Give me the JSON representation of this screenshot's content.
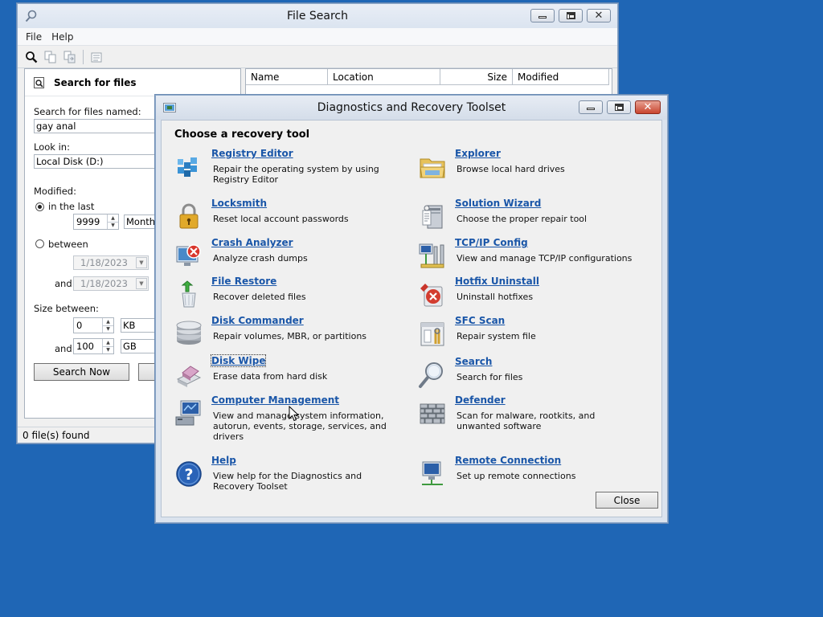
{
  "file_search": {
    "title": "File Search",
    "menu": [
      "File",
      "Help"
    ],
    "panel_title": "Search for files",
    "search_named_label": "Search for files named:",
    "search_named_value": "gay anal",
    "look_in_label": "Look in:",
    "look_in_value": "Local Disk (D:)",
    "modified_label": "Modified:",
    "in_the_last_label": "in the last",
    "in_the_last_value": "9999",
    "in_the_last_unit": "Months",
    "between_label": "between",
    "date_from": "1/18/2023",
    "and_label": "and",
    "date_to": "1/18/2023",
    "size_between_label": "Size between:",
    "size_min": "0",
    "size_min_unit": "KB",
    "size_and_label": "and",
    "size_max": "100",
    "size_max_unit": "GB",
    "search_button": "Search Now",
    "columns": [
      "Name",
      "Location",
      "Size",
      "Modified"
    ],
    "status": "0 file(s) found"
  },
  "dart": {
    "title": "Diagnostics and Recovery Toolset",
    "heading": "Choose a recovery tool",
    "tools_left": [
      {
        "name": "Registry Editor",
        "desc": "Repair the operating system by using Registry Editor",
        "icon": "registry-icon"
      },
      {
        "name": "Locksmith",
        "desc": "Reset local account passwords",
        "icon": "padlock-icon"
      },
      {
        "name": "Crash Analyzer",
        "desc": "Analyze crash dumps",
        "icon": "crash-icon"
      },
      {
        "name": "File Restore",
        "desc": "Recover deleted files",
        "icon": "recycle-bin-icon"
      },
      {
        "name": "Disk Commander",
        "desc": "Repair volumes, MBR, or partitions",
        "icon": "disk-stack-icon"
      },
      {
        "name": "Disk Wipe",
        "desc": "Erase data from hard disk",
        "icon": "eraser-icon"
      },
      {
        "name": "Computer Management",
        "desc": "View and manage system information, autorun, events, storage, services, and drivers",
        "icon": "computer-management-icon"
      },
      {
        "name": "Help",
        "desc": "View help for the Diagnostics and Recovery Toolset",
        "icon": "help-icon"
      }
    ],
    "tools_right": [
      {
        "name": "Explorer",
        "desc": "Browse local hard drives",
        "icon": "folder-icon"
      },
      {
        "name": "Solution Wizard",
        "desc": "Choose the proper repair tool",
        "icon": "wizard-icon"
      },
      {
        "name": "TCP/IP Config",
        "desc": "View and manage TCP/IP configurations",
        "icon": "network-icon"
      },
      {
        "name": "Hotfix Uninstall",
        "desc": "Uninstall hotfixes",
        "icon": "hotfix-icon"
      },
      {
        "name": "SFC Scan",
        "desc": "Repair system file",
        "icon": "sfc-icon"
      },
      {
        "name": "Search",
        "desc": "Search for files",
        "icon": "magnifier-icon"
      },
      {
        "name": "Defender",
        "desc": "Scan for malware, rootkits, and unwanted software",
        "icon": "wall-icon"
      },
      {
        "name": "Remote Connection",
        "desc": "Set up remote connections",
        "icon": "remote-icon"
      }
    ],
    "close_button": "Close"
  }
}
